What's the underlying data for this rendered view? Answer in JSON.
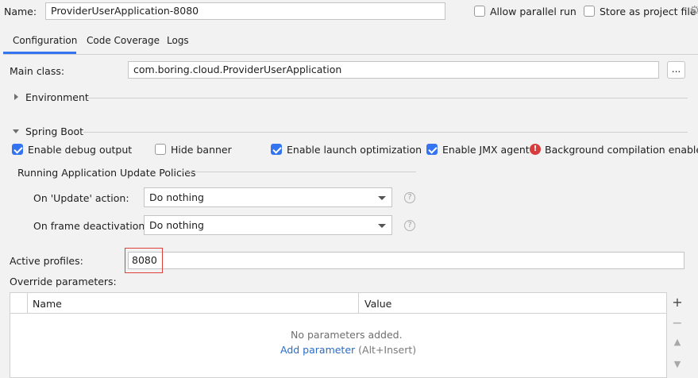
{
  "header": {
    "name_label": "Name:",
    "name_value": "ProviderUserApplication-8080",
    "allow_parallel_label": "Allow parallel run",
    "allow_parallel_checked": false,
    "store_project_label": "Store as project file"
  },
  "tabs": [
    {
      "label": "Configuration",
      "active": true
    },
    {
      "label": "Code Coverage",
      "active": false
    },
    {
      "label": "Logs",
      "active": false
    }
  ],
  "main_class": {
    "label": "Main class:",
    "value": "com.boring.cloud.ProviderUserApplication",
    "browse_label": "..."
  },
  "environment": {
    "label": "Environment",
    "expanded": false
  },
  "spring_boot": {
    "label": "Spring Boot",
    "expanded": true,
    "options": [
      {
        "label": "Enable debug output",
        "checked": true
      },
      {
        "label": "Hide banner",
        "checked": false
      },
      {
        "label": "Enable launch optimization",
        "checked": true
      },
      {
        "label": "Enable JMX agent",
        "checked": true
      }
    ],
    "warning_text": "Background compilation enabled",
    "policies": {
      "title": "Running Application Update Policies",
      "update_label": "On 'Update' action:",
      "update_value": "Do nothing",
      "frame_label": "On frame deactivation:",
      "frame_value": "Do nothing",
      "help_glyph": "?"
    }
  },
  "profiles": {
    "label": "Active profiles:",
    "value": "8080",
    "highlight_color": "#e0403c"
  },
  "override": {
    "label": "Override parameters:",
    "columns": [
      "Name",
      "Value"
    ],
    "empty_text": "No parameters added.",
    "add_link": "Add parameter",
    "add_shortcut": "(Alt+Insert)",
    "tools": [
      "+",
      "−",
      "▲",
      "▼"
    ]
  },
  "colors": {
    "accent": "#3574f0",
    "link": "#2a6cc7",
    "warning": "#d93c3c",
    "background": "#f2f2f2"
  }
}
